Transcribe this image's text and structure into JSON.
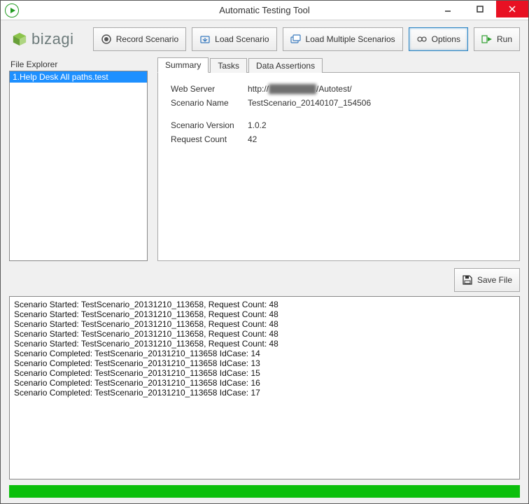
{
  "window": {
    "title": "Automatic Testing Tool"
  },
  "logo": {
    "text": "bizagi"
  },
  "toolbar": {
    "record": "Record Scenario",
    "load": "Load Scenario",
    "load_multiple": "Load Multiple Scenarios",
    "options": "Options",
    "run": "Run"
  },
  "file_explorer": {
    "title": "File Explorer",
    "items": [
      "1.Help Desk All paths.test"
    ]
  },
  "tabs": {
    "summary": "Summary",
    "tasks": "Tasks",
    "data_assertions": "Data Assertions"
  },
  "summary": {
    "web_server_label": "Web Server",
    "web_server_prefix": "http://",
    "web_server_hidden": "████████",
    "web_server_suffix": "/Autotest/",
    "scenario_name_label": "Scenario Name",
    "scenario_name": "TestScenario_20140107_154506",
    "scenario_version_label": "Scenario Version",
    "scenario_version": "1.0.2",
    "request_count_label": "Request Count",
    "request_count": "42"
  },
  "save_file": "Save File",
  "log_lines": [
    "Scenario Started: TestScenario_20131210_113658, Request Count: 48",
    "Scenario Started: TestScenario_20131210_113658, Request Count: 48",
    "Scenario Started: TestScenario_20131210_113658, Request Count: 48",
    "Scenario Started: TestScenario_20131210_113658, Request Count: 48",
    "Scenario Started: TestScenario_20131210_113658, Request Count: 48",
    "Scenario Completed: TestScenario_20131210_113658 IdCase: 14",
    "Scenario Completed: TestScenario_20131210_113658 IdCase: 13",
    "Scenario Completed: TestScenario_20131210_113658 IdCase: 15",
    "Scenario Completed: TestScenario_20131210_113658 IdCase: 16",
    "Scenario Completed: TestScenario_20131210_113658 IdCase: 17"
  ]
}
